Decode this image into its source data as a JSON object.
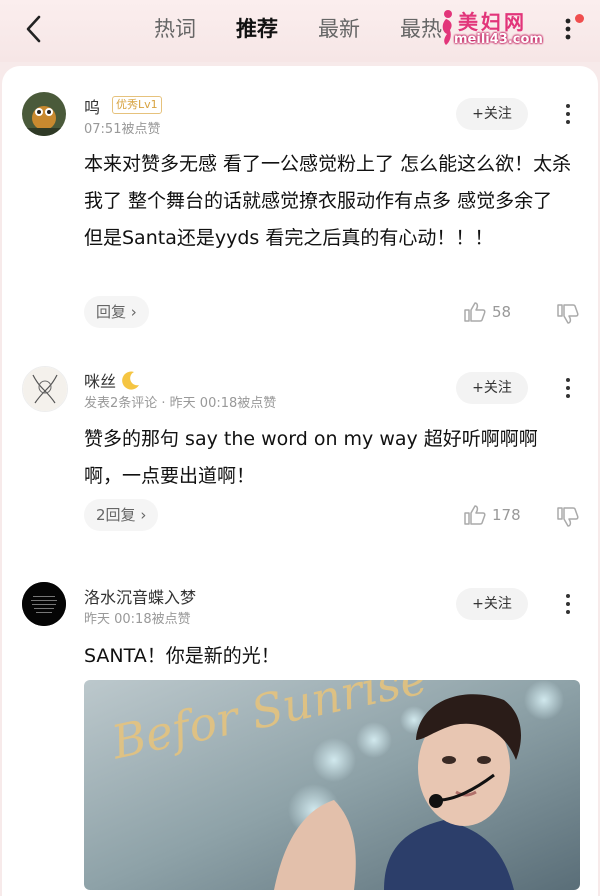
{
  "header": {
    "tabs": [
      {
        "label": "热词",
        "active": false
      },
      {
        "label": "推荐",
        "active": true
      },
      {
        "label": "最新",
        "active": false
      },
      {
        "label": "最热",
        "active": false
      }
    ],
    "watermark": {
      "title": "美妇网",
      "url": "meili43.com"
    },
    "accent_color": "#f04e4e"
  },
  "comments": [
    {
      "user": "呜",
      "badge": "优秀Lv1",
      "meta": "07:51被点赞",
      "follow_label": "+关注",
      "text": "本来对赞多无感 看了一公感觉粉上了 怎么能这么欲！太杀我了 整个舞台的话就感觉撩衣服动作有点多 感觉多余了 但是Santa还是yyds 看完之后真的有心动！！！",
      "reply_label": "回复",
      "likes": "58"
    },
    {
      "user": "咪丝",
      "user_icon": "moon-icon",
      "meta": "发表2条评论 · 昨天 00:18被点赞",
      "follow_label": "+关注",
      "text": "赞多的那句 say the word on my  way 超好听啊啊啊啊，一点要出道啊！",
      "reply_label": "2回复",
      "likes": "178"
    },
    {
      "user": "洛水沉音蝶入梦",
      "meta": "昨天 00:18被点赞",
      "follow_label": "+关注",
      "text": "SANTA！你是新的光！",
      "image_text": "Befor Sunrise"
    }
  ]
}
